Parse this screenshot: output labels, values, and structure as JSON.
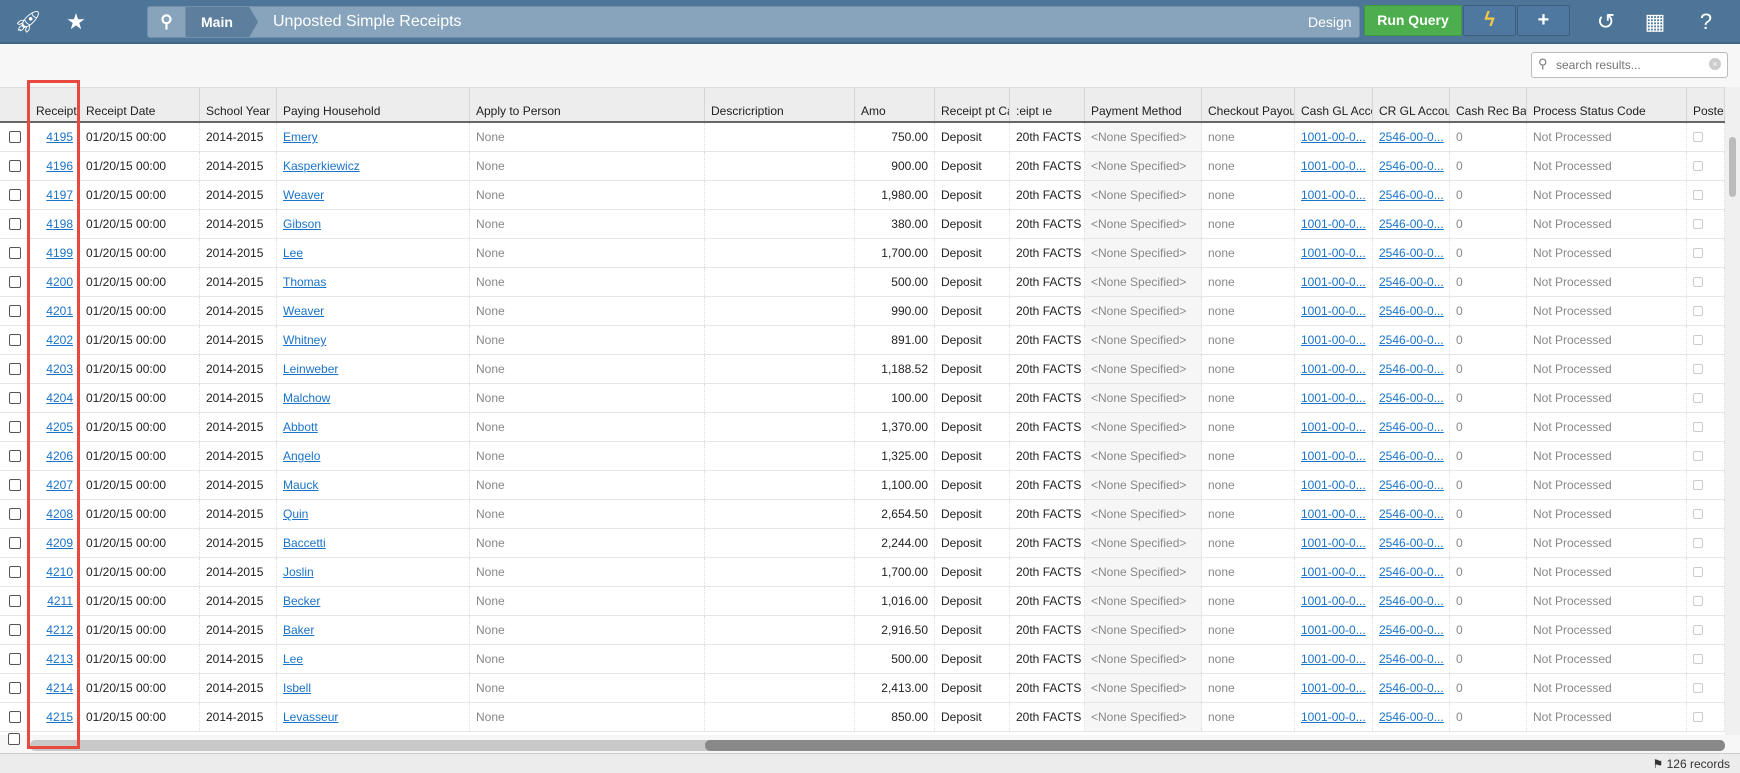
{
  "topbar": {
    "title": "Unposted Simple Receipts",
    "crumb": "Main",
    "design_label": "Design",
    "run_query_label": "Run Query",
    "icons": [
      "rocket-icon",
      "star-icon",
      "search-icon",
      "lightning-icon",
      "plus-icon",
      "history-icon",
      "dashboard-icon",
      "help-icon"
    ]
  },
  "search": {
    "placeholder": "search results..."
  },
  "columns": [
    "Receipt ID",
    "Receipt Date",
    "School Year",
    "Paying Household",
    "Apply to Person",
    "Descricription",
    "Amo",
    "Receipt pt Categor͵ory",
    ":eipt ıe",
    "Payment Method",
    "Checkout Payout",
    "Cash GL Account",
    "CR GL Account",
    "Cash Rec Batch",
    "Process Status Code",
    "Postec"
  ],
  "rows": [
    {
      "id": "4195",
      "hh": "Emery",
      "amt": "750.00"
    },
    {
      "id": "4196",
      "hh": "Kasperkiewicz",
      "amt": "900.00"
    },
    {
      "id": "4197",
      "hh": "Weaver",
      "amt": "1,980.00"
    },
    {
      "id": "4198",
      "hh": "Gibson",
      "amt": "380.00"
    },
    {
      "id": "4199",
      "hh": "Lee",
      "amt": "1,700.00"
    },
    {
      "id": "4200",
      "hh": "Thomas",
      "amt": "500.00"
    },
    {
      "id": "4201",
      "hh": "Weaver",
      "amt": "990.00"
    },
    {
      "id": "4202",
      "hh": "Whitney",
      "amt": "891.00"
    },
    {
      "id": "4203",
      "hh": "Leinweber",
      "amt": "1,188.52"
    },
    {
      "id": "4204",
      "hh": "Malchow",
      "amt": "100.00"
    },
    {
      "id": "4205",
      "hh": "Abbott",
      "amt": "1,370.00"
    },
    {
      "id": "4206",
      "hh": "Angelo",
      "amt": "1,325.00"
    },
    {
      "id": "4207",
      "hh": "Mauck",
      "amt": "1,100.00"
    },
    {
      "id": "4208",
      "hh": "Quin",
      "amt": "2,654.50"
    },
    {
      "id": "4209",
      "hh": "Baccetti",
      "amt": "2,244.00"
    },
    {
      "id": "4210",
      "hh": "Joslin",
      "amt": "1,700.00"
    },
    {
      "id": "4211",
      "hh": "Becker",
      "amt": "1,016.00"
    },
    {
      "id": "4212",
      "hh": "Baker",
      "amt": "2,916.50"
    },
    {
      "id": "4213",
      "hh": "Lee",
      "amt": "500.00"
    },
    {
      "id": "4214",
      "hh": "Isbell",
      "amt": "2,413.00"
    },
    {
      "id": "4215",
      "hh": "Levasseur",
      "amt": "850.00"
    }
  ],
  "row_defaults": {
    "date": "01/20/15 00:00",
    "year": "2014-2015",
    "apply": "None",
    "category": "Deposit",
    "type": "20th FACTS",
    "payment": "<None Specified>",
    "payout": "none",
    "cash_gl": "1001-00-0...",
    "cr_gl": "2546-00-0...",
    "batch": "0",
    "status": "Not Processed"
  },
  "footer": {
    "records": "126 records"
  },
  "colors": {
    "topbar": "#4d7598",
    "run_query": "#4cae4c",
    "link": "#1a73c9",
    "highlight": "#e8493f"
  }
}
